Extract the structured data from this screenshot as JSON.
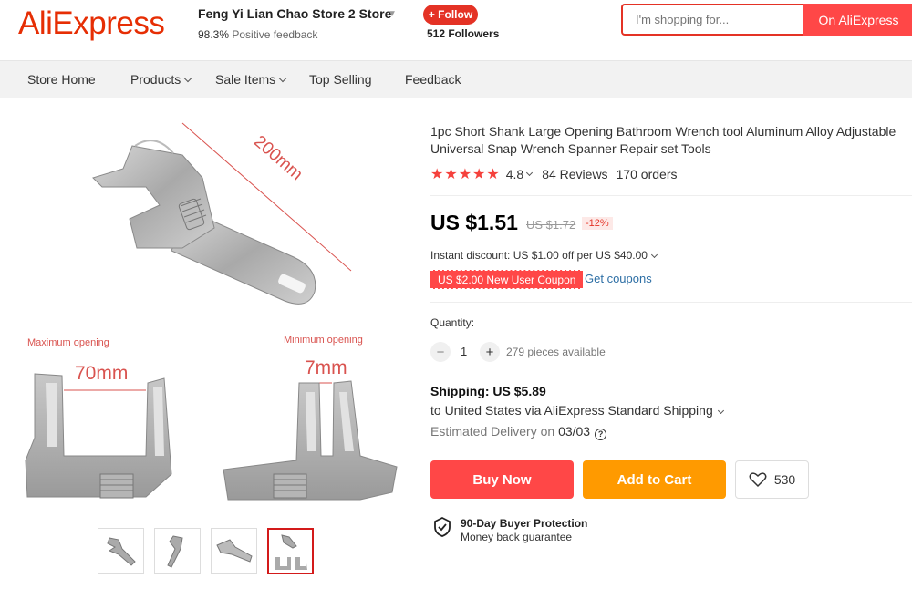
{
  "header": {
    "logo": "AliExpress",
    "store_name": "Feng Yi Lian Chao Store 2 Store",
    "feedback_percent": "98.3%",
    "feedback_label": "Positive feedback",
    "follow_label": "+ Follow",
    "followers": "512 Followers",
    "search_placeholder": "I'm shopping for...",
    "search_button": "On AliExpress"
  },
  "nav": {
    "items": [
      "Store Home",
      "Products",
      "Sale Items",
      "Top Selling",
      "Feedback"
    ]
  },
  "gallery": {
    "main_labels": {
      "length": "200mm",
      "max_title": "Maximum opening",
      "max_value": "70mm",
      "min_title": "Minimum opening",
      "min_value": "7mm"
    },
    "thumbnail_count": 4,
    "active_thumbnail": 4
  },
  "product": {
    "title": "1pc Short Shank Large Opening Bathroom Wrench tool Aluminum Alloy Adjustable Universal Snap Wrench Spanner Repair set Tools",
    "stars": 5,
    "rating": "4.8",
    "reviews": "84 Reviews",
    "orders": "170 orders",
    "price": "US $1.51",
    "old_price": "US $1.72",
    "discount": "-12%",
    "instant_discount": "Instant discount: US $1.00 off per US $40.00",
    "coupon": "US $2.00 New User Coupon",
    "get_coupons": "Get coupons",
    "quantity_label": "Quantity:",
    "quantity": "1",
    "available": "279 pieces available",
    "shipping_title": "Shipping: US $5.89",
    "shipping_to": "to United States via AliExpress Standard Shipping",
    "estimated_label": "Estimated Delivery on",
    "estimated_date": "03/03",
    "buy_now": "Buy Now",
    "add_to_cart": "Add to Cart",
    "wishlist_count": "530",
    "protection_title": "90-Day Buyer Protection",
    "protection_sub": "Money back guarantee"
  },
  "colors": {
    "brand": "#e62e04",
    "buy": "#ff4747",
    "cart": "#ff9a00",
    "star": "#f5413c",
    "link": "#2e6fa5"
  }
}
